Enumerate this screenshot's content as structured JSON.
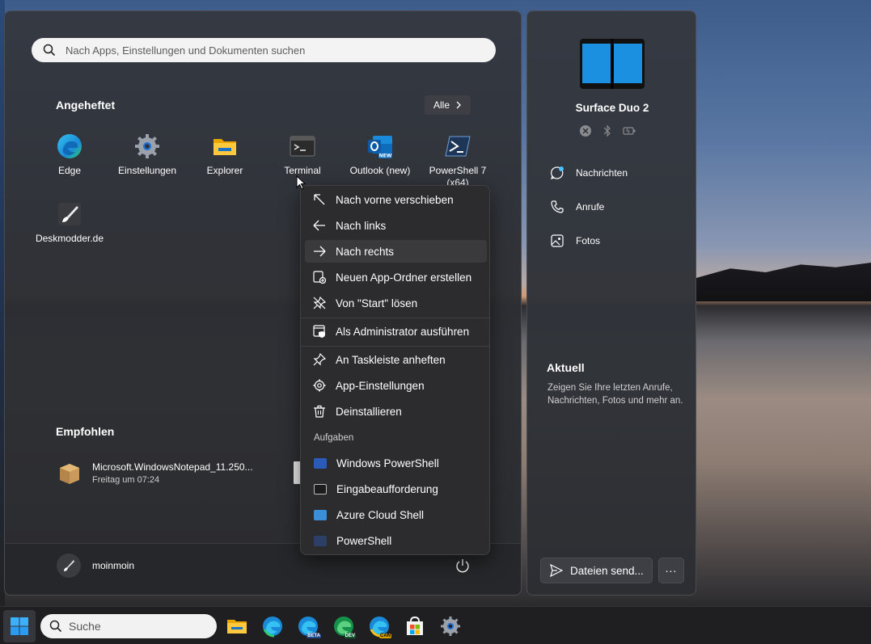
{
  "start_menu": {
    "search_placeholder": "Nach Apps, Einstellungen und Dokumenten suchen",
    "pinned_title": "Angeheftet",
    "all_button": "Alle",
    "pinned_apps": [
      {
        "label": "Edge",
        "icon": "edge-icon"
      },
      {
        "label": "Einstellungen",
        "icon": "settings-gear-icon"
      },
      {
        "label": "Explorer",
        "icon": "folder-icon"
      },
      {
        "label": "Terminal",
        "icon": "terminal-icon"
      },
      {
        "label": "Outlook (new)",
        "icon": "outlook-icon"
      },
      {
        "label": "PowerShell 7 (x64)",
        "icon": "powershell-icon"
      },
      {
        "label": "Deskmodder.de",
        "icon": "brush-icon"
      }
    ],
    "recommended_title": "Empfohlen",
    "recommended": [
      {
        "title": "Microsoft.WindowsNotepad_11.250...",
        "subtitle": "Freitag um 07:24",
        "icon": "package-icon"
      }
    ],
    "user_name": "moinmoin"
  },
  "context_menu": {
    "items": [
      {
        "label": "Nach vorne verschieben",
        "icon": "arrow-up-left-icon"
      },
      {
        "label": "Nach links",
        "icon": "arrow-left-icon"
      },
      {
        "label": "Nach rechts",
        "icon": "arrow-right-icon"
      },
      {
        "label": "Neuen App-Ordner erstellen",
        "icon": "new-folder-icon"
      },
      {
        "label": "Von \"Start\" lösen",
        "icon": "unpin-icon"
      },
      {
        "label": "Als Administrator ausführen",
        "icon": "shield-window-icon"
      },
      {
        "label": "An Taskleiste anheften",
        "icon": "pin-icon"
      },
      {
        "label": "App-Einstellungen",
        "icon": "gear-icon"
      },
      {
        "label": "Deinstallieren",
        "icon": "trash-icon"
      }
    ],
    "tasks_header": "Aufgaben",
    "tasks": [
      {
        "label": "Windows PowerShell",
        "color": "#2a5bb8"
      },
      {
        "label": "Eingabeaufforderung",
        "color": "#1c1c1c"
      },
      {
        "label": "Azure Cloud Shell",
        "color": "#3b8fd6"
      },
      {
        "label": "PowerShell",
        "color": "#2c3f66"
      }
    ]
  },
  "phone_panel": {
    "device_name": "Surface Duo 2",
    "nav": [
      {
        "label": "Nachrichten",
        "icon": "chat-icon"
      },
      {
        "label": "Anrufe",
        "icon": "phone-icon"
      },
      {
        "label": "Fotos",
        "icon": "photo-icon"
      }
    ],
    "recent_title": "Aktuell",
    "recent_desc": "Zeigen Sie Ihre letzten Anrufe, Nachrichten, Fotos und mehr an.",
    "send_button": "Dateien send...",
    "more_button": "..."
  },
  "taskbar": {
    "search_placeholder": "Suche",
    "icons": [
      "windows-start-icon",
      "file-explorer-icon",
      "edge-icon",
      "edge-beta-icon",
      "edge-dev-icon",
      "edge-canary-icon",
      "store-icon",
      "settings-icon"
    ],
    "badges": {
      "beta": "BETA",
      "dev": "DEV",
      "canary": "CAN"
    }
  },
  "colors": {
    "accent": "#0078d4",
    "menu_bg": "#2c2c2e",
    "panel_bg": "#2d2f33"
  }
}
